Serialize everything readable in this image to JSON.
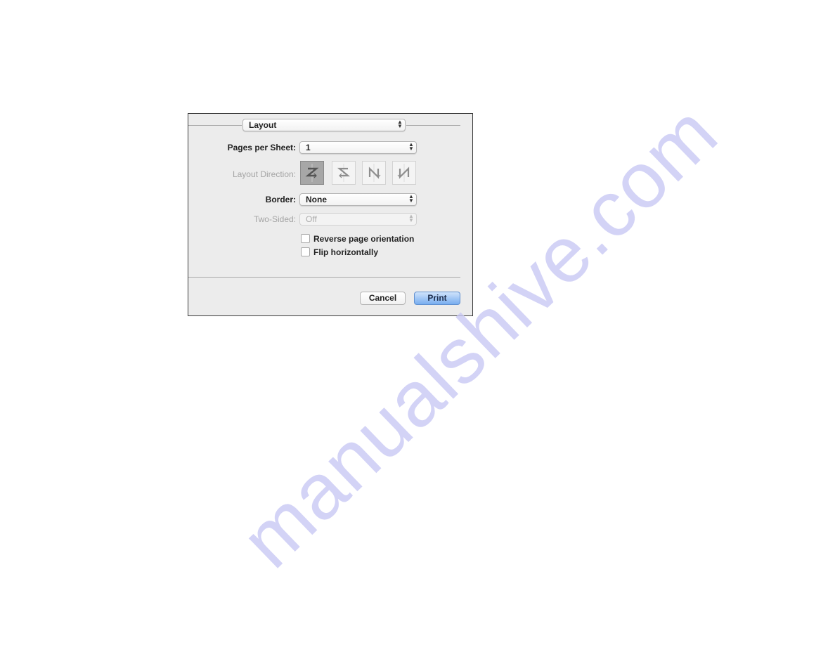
{
  "dialog": {
    "panel_selector": {
      "value": "Layout"
    },
    "pages_per_sheet": {
      "label": "Pages per Sheet:",
      "value": "1"
    },
    "layout_direction": {
      "label": "Layout Direction:",
      "options": [
        {
          "icon": "z-order-icon",
          "selected": true
        },
        {
          "icon": "reverse-z-order-icon",
          "selected": false
        },
        {
          "icon": "n-order-icon",
          "selected": false
        },
        {
          "icon": "reverse-n-order-icon",
          "selected": false
        }
      ]
    },
    "border": {
      "label": "Border:",
      "value": "None"
    },
    "two_sided": {
      "label": "Two-Sided:",
      "value": "Off",
      "disabled": true
    },
    "checkboxes": [
      {
        "label": "Reverse page orientation",
        "checked": false
      },
      {
        "label": "Flip horizontally",
        "checked": false
      }
    ],
    "buttons": {
      "cancel": "Cancel",
      "print": "Print"
    },
    "colors": {
      "print_button": "#78adef",
      "dialog_bg": "#ececec"
    }
  },
  "watermark": {
    "text": "manualshive.com"
  }
}
